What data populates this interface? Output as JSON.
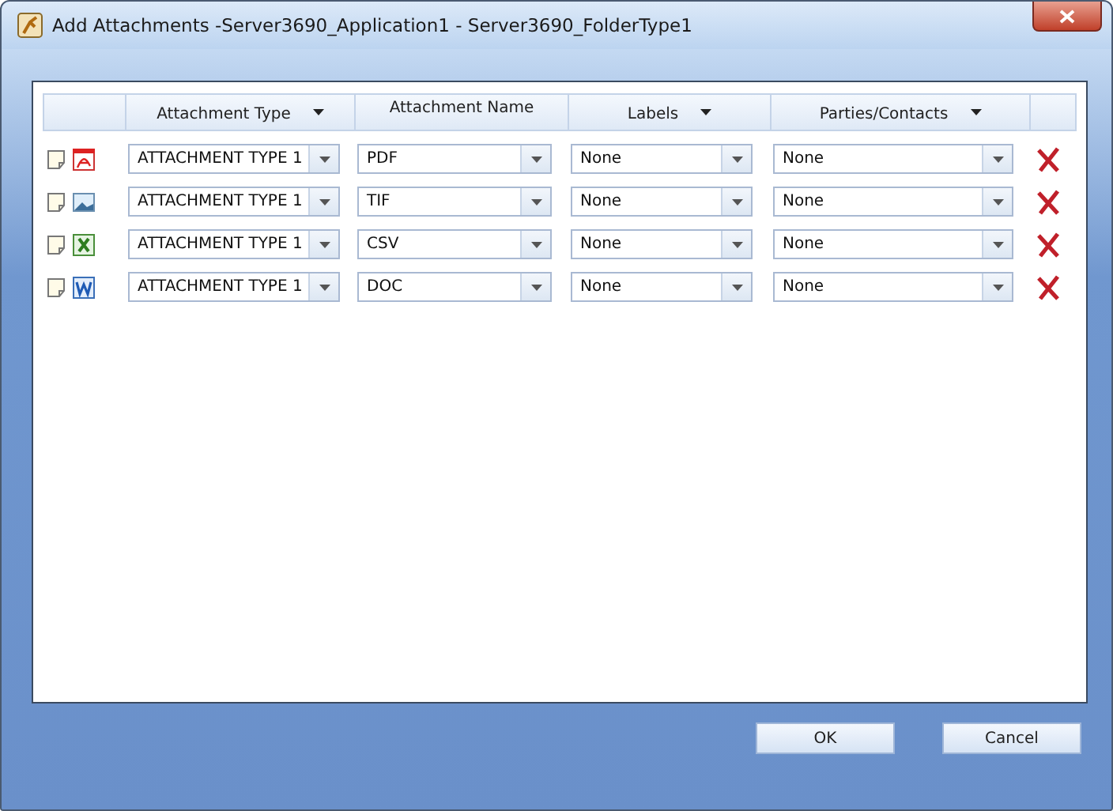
{
  "window": {
    "title": "Add Attachments -Server3690_Application1 - Server3690_FolderType1"
  },
  "columns": [
    {
      "label": "Attachment Type",
      "menu": true
    },
    {
      "label": "Attachment Name",
      "menu": false
    },
    {
      "label": "Labels",
      "menu": true
    },
    {
      "label": "Parties/Contacts",
      "menu": true
    }
  ],
  "rows": [
    {
      "kind": "pdf",
      "type": "ATTACHMENT TYPE 1",
      "name": "PDF",
      "labels": "None",
      "parties": "None"
    },
    {
      "kind": "image",
      "type": "ATTACHMENT TYPE 1",
      "name": "TIF",
      "labels": "None",
      "parties": "None"
    },
    {
      "kind": "excel",
      "type": "ATTACHMENT TYPE 1",
      "name": "CSV",
      "labels": "None",
      "parties": "None"
    },
    {
      "kind": "word",
      "type": "ATTACHMENT TYPE 1",
      "name": "DOC",
      "labels": "None",
      "parties": "None"
    }
  ],
  "buttons": [
    "OK",
    "Cancel"
  ]
}
